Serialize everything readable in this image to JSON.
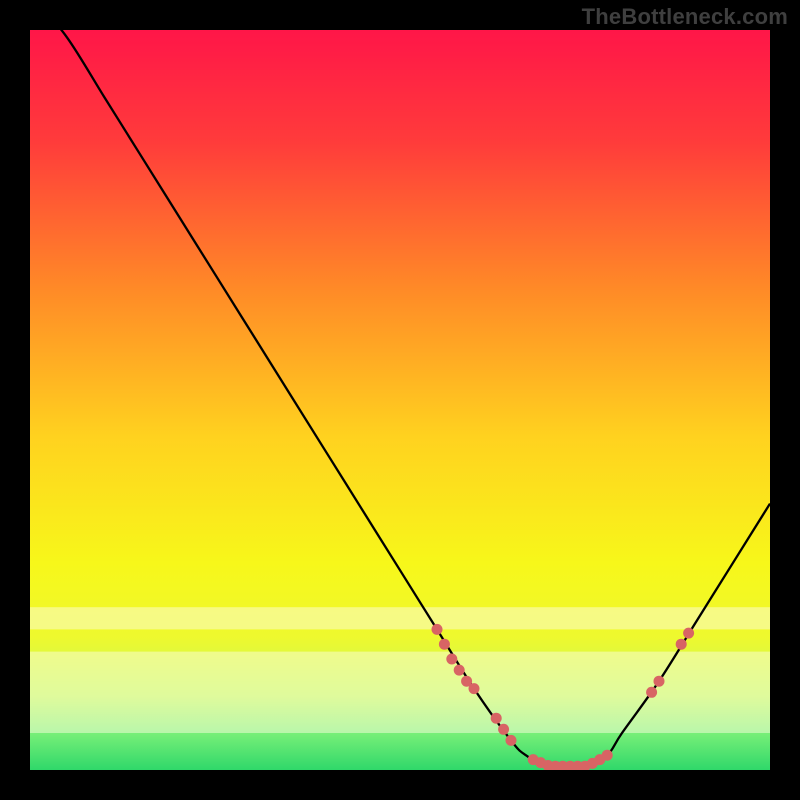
{
  "watermark": "TheBottleneck.com",
  "chart_data": {
    "type": "line",
    "title": "",
    "xlabel": "",
    "ylabel": "",
    "xlim": [
      0,
      100
    ],
    "ylim": [
      0,
      100
    ],
    "x": [
      0,
      5,
      10,
      15,
      20,
      25,
      30,
      35,
      40,
      45,
      50,
      55,
      60,
      65,
      67,
      70,
      75,
      78,
      80,
      85,
      90,
      95,
      100
    ],
    "values": [
      105,
      99,
      91,
      83,
      75,
      67,
      59,
      51,
      43,
      35,
      27,
      19,
      11,
      4,
      2,
      0.5,
      0.5,
      2,
      5,
      12,
      20,
      28,
      36
    ],
    "markers": [
      {
        "x": 55,
        "y": 19
      },
      {
        "x": 56,
        "y": 17
      },
      {
        "x": 57,
        "y": 15
      },
      {
        "x": 58,
        "y": 13.5
      },
      {
        "x": 59,
        "y": 12
      },
      {
        "x": 60,
        "y": 11
      },
      {
        "x": 63,
        "y": 7
      },
      {
        "x": 64,
        "y": 5.5
      },
      {
        "x": 65,
        "y": 4
      },
      {
        "x": 68,
        "y": 1.4
      },
      {
        "x": 69,
        "y": 1.0
      },
      {
        "x": 70,
        "y": 0.6
      },
      {
        "x": 71,
        "y": 0.5
      },
      {
        "x": 72,
        "y": 0.5
      },
      {
        "x": 73,
        "y": 0.5
      },
      {
        "x": 74,
        "y": 0.5
      },
      {
        "x": 75,
        "y": 0.5
      },
      {
        "x": 76,
        "y": 0.9
      },
      {
        "x": 77,
        "y": 1.4
      },
      {
        "x": 78,
        "y": 2.0
      },
      {
        "x": 84,
        "y": 10.5
      },
      {
        "x": 85,
        "y": 12
      },
      {
        "x": 88,
        "y": 17
      },
      {
        "x": 89,
        "y": 18.5
      }
    ],
    "gradient": {
      "stops": [
        {
          "offset": 0.0,
          "color": "#ff1648"
        },
        {
          "offset": 0.15,
          "color": "#ff3b3b"
        },
        {
          "offset": 0.35,
          "color": "#ff8a27"
        },
        {
          "offset": 0.55,
          "color": "#ffd21f"
        },
        {
          "offset": 0.72,
          "color": "#f7f71a"
        },
        {
          "offset": 0.82,
          "color": "#eef92e"
        },
        {
          "offset": 0.9,
          "color": "#c3f85a"
        },
        {
          "offset": 0.95,
          "color": "#78ef78"
        },
        {
          "offset": 1.0,
          "color": "#2fd86a"
        }
      ]
    },
    "curve_color": "#000000",
    "marker_color": "#d86464"
  }
}
